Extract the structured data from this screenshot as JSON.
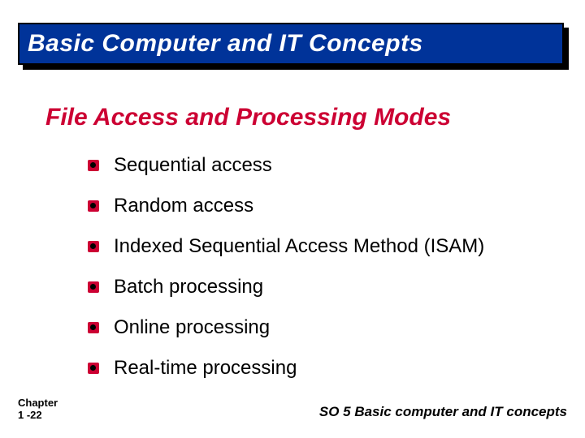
{
  "header": {
    "title": "Basic Computer and IT Concepts"
  },
  "subtitle": "File Access and Processing Modes",
  "bullets": [
    "Sequential access",
    "Random access",
    "Indexed Sequential Access Method (ISAM)",
    "Batch processing",
    "Online processing",
    "Real-time processing"
  ],
  "footer": {
    "left_line1": "Chapter",
    "left_line2": "1 -22",
    "right": "SO 5  Basic computer and IT concepts"
  }
}
